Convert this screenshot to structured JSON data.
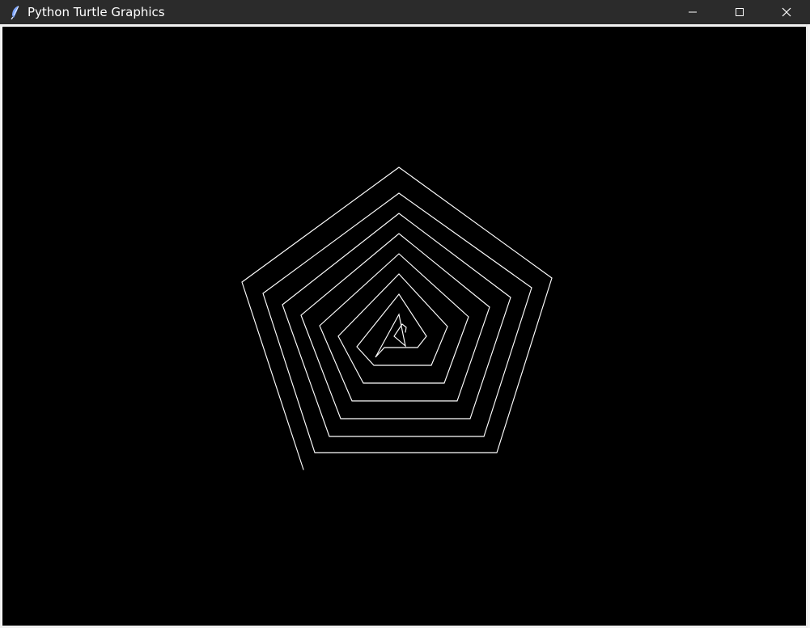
{
  "window": {
    "title": "Python Turtle Graphics",
    "app_icon": "feather-icon",
    "controls": {
      "minimize_icon": "minimize-icon",
      "maximize_icon": "maximize-icon",
      "close_icon": "close-icon"
    }
  },
  "canvas": {
    "background_color": "#000000",
    "pen_color": "#ffffff",
    "shape": "pentagon spiral"
  },
  "colors": {
    "titlebar": "#2b2b2b",
    "title_text": "#ffffff",
    "frame": "#f0f0f0"
  }
}
